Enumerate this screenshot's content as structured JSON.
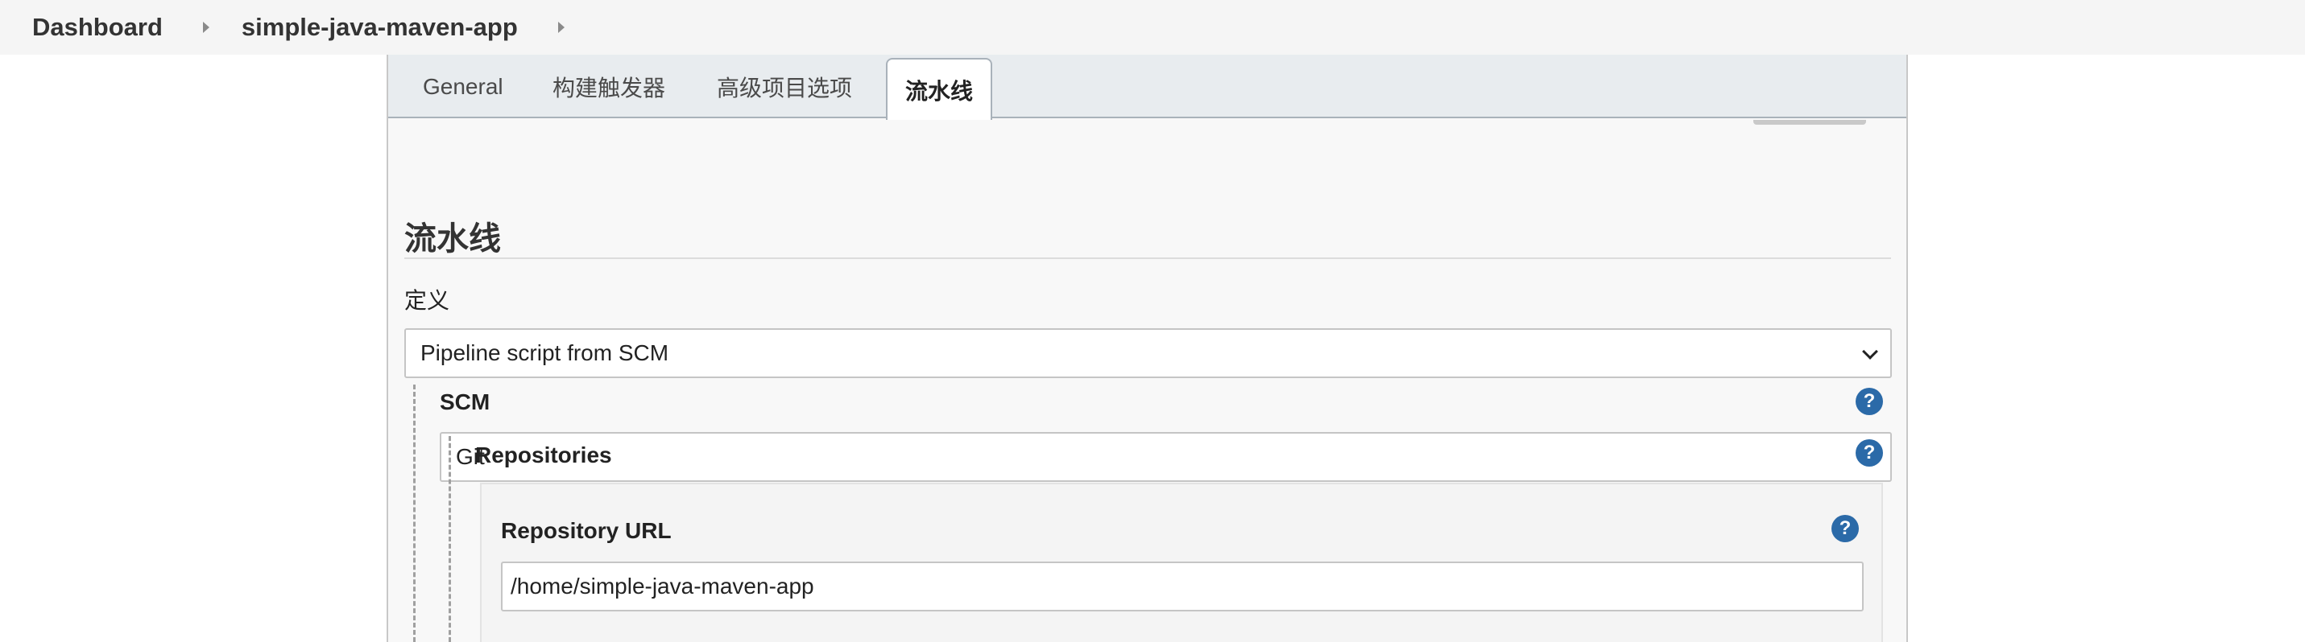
{
  "breadcrumb": {
    "items": [
      "Dashboard",
      "simple-java-maven-app"
    ]
  },
  "tabs": [
    {
      "label": "General",
      "active": false
    },
    {
      "label": "构建触发器",
      "active": false
    },
    {
      "label": "高级项目选项",
      "active": false
    },
    {
      "label": "流水线",
      "active": true
    }
  ],
  "section": {
    "title": "流水线",
    "definition_label": "定义",
    "definition_value": "Pipeline script from SCM",
    "scm_label": "SCM",
    "scm_value": "Git",
    "repositories_label": "Repositories",
    "repository_url_label": "Repository URL",
    "repository_url_value": "/home/simple-java-maven-app"
  },
  "icons": {
    "help": "help-icon",
    "breadcrumb_separator": "chevron-right-icon",
    "select_arrow": "chevron-down-icon"
  },
  "colors": {
    "help_icon": "#2b6aa8",
    "tabbar_bg": "#e8ecef",
    "panel_bg": "#f8f8f8"
  }
}
